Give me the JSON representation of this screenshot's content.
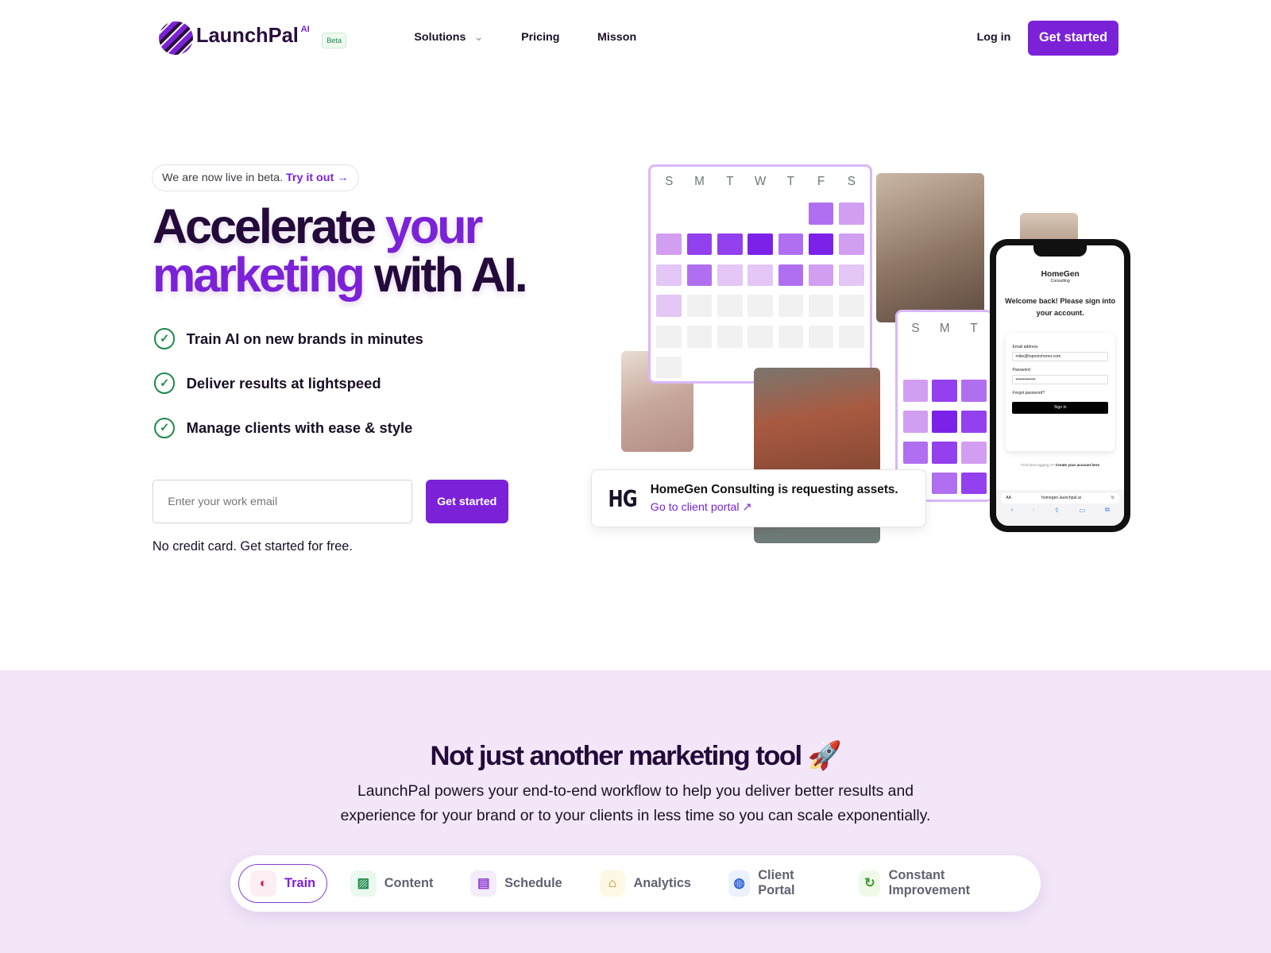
{
  "header": {
    "brand": "LaunchPal",
    "brand_sup": "AI",
    "beta_badge": "Beta",
    "nav": [
      "Solutions",
      "Pricing",
      "Misson"
    ],
    "login": "Log in",
    "cta": "Get started"
  },
  "hero": {
    "announcement": "We are now live in beta.",
    "announcement_link": "Try it out →",
    "headline": {
      "part1": "Accelerate ",
      "part2": "your",
      "part3": "marketing",
      "part4": " with AI."
    },
    "features": [
      "Train AI on new brands in minutes",
      "Deliver results at lightspeed",
      "Manage clients with ease & style"
    ],
    "email_placeholder": "Enter your work email",
    "cta": "Get started",
    "note": "No credit card. Get started for free."
  },
  "calendar": {
    "days": [
      "S",
      "M",
      "T",
      "W",
      "T",
      "F",
      "S"
    ],
    "levels": [
      [
        null,
        null,
        null,
        null,
        null,
        3,
        2
      ],
      [
        2,
        4,
        4,
        5,
        3,
        5,
        2
      ],
      [
        1,
        3,
        1,
        1,
        3,
        2,
        1
      ],
      [
        1,
        0,
        0,
        0,
        0,
        0,
        0
      ],
      [
        0,
        0,
        0,
        0,
        0,
        0,
        0
      ],
      [
        0,
        null,
        null,
        null,
        null,
        null,
        null
      ]
    ],
    "colors": [
      "#f1f1f1",
      "#e4c6f7",
      "#d29ef2",
      "#b06ff0",
      "#9340ef",
      "#7c22e8"
    ]
  },
  "calendar2": {
    "days": [
      "S",
      "M",
      "T"
    ],
    "levels": [
      [
        2,
        4,
        3
      ],
      [
        2,
        5,
        4
      ],
      [
        3,
        4,
        2
      ],
      [
        null,
        3,
        4
      ]
    ]
  },
  "notification": {
    "logo": "HG",
    "title": "HomeGen Consulting is requesting assets.",
    "link": "Go to client portal ↗"
  },
  "phone": {
    "brand": "HomeGen",
    "brand_sub": "Consulting",
    "welcome": "Welcome back! Please sign into your account.",
    "email_label": "Email address",
    "email_value": "mike@topnotchreno.com",
    "password_label": "Password",
    "password_value": "••••••••••••••",
    "forgot": "Forgot password?",
    "signin": "Sign in",
    "first_time": "First time logging in?",
    "create": "Create your account here",
    "url": "homegen.launchpal.ai",
    "aa": "AA"
  },
  "section2": {
    "title": "Not just another marketing tool 🚀",
    "body": "LaunchPal powers your end-to-end workflow to help you deliver better results and experience for your brand or to your clients in less time so you can scale exponentially.",
    "tabs": [
      {
        "label": "Train",
        "icon": "brain-icon",
        "glyph": "◐",
        "color": "#d0245c",
        "bg": "#fdeef3"
      },
      {
        "label": "Content",
        "icon": "image-icon",
        "glyph": "▨",
        "color": "#1f8a4c",
        "bg": "#eaf8ef"
      },
      {
        "label": "Schedule",
        "icon": "calendar-icon",
        "glyph": "▤",
        "color": "#8b3bd0",
        "bg": "#f4ecfb"
      },
      {
        "label": "Analytics",
        "icon": "presentation-chart-icon",
        "glyph": "⌂",
        "color": "#b7791f",
        "bg": "#fdf8e3"
      },
      {
        "label": "Client Portal",
        "icon": "globe-icon",
        "glyph": "◍",
        "color": "#2b5ed8",
        "bg": "#ebf1fd"
      },
      {
        "label": "Constant Improvement",
        "icon": "refresh-icon",
        "glyph": "↻",
        "color": "#3d9a2f",
        "bg": "#f0f9e8"
      }
    ]
  }
}
